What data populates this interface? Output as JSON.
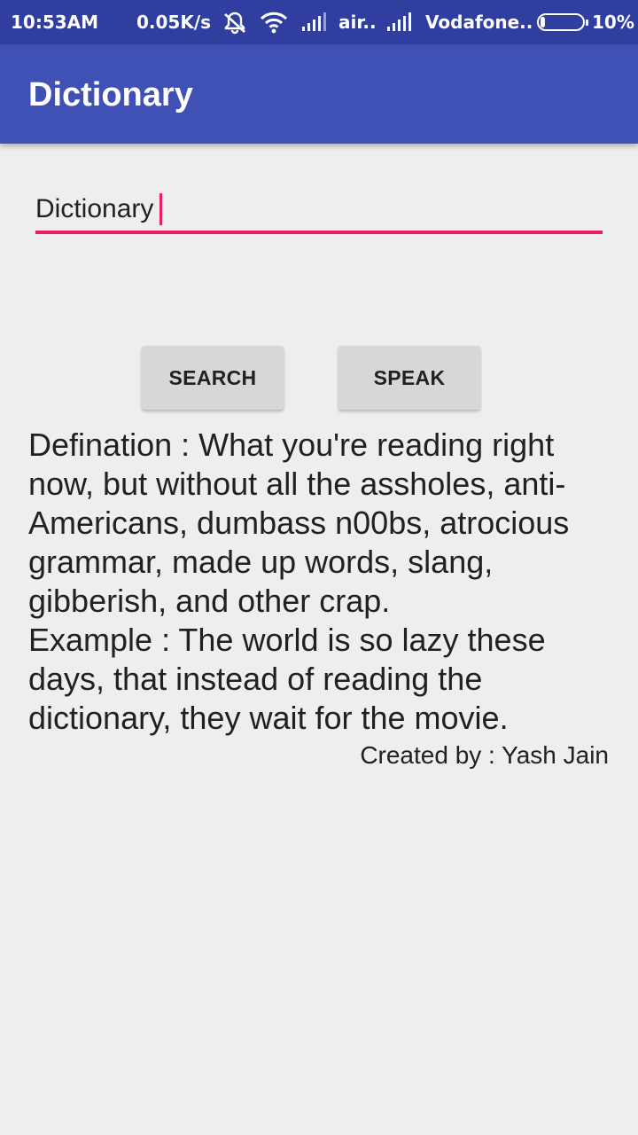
{
  "status_bar": {
    "time": "10:53AM",
    "net_speed": "0.05K/s",
    "carrier_1": "air..",
    "carrier_2": "Vodafone..",
    "battery_percent": "10%",
    "battery_level": 0.1
  },
  "app_bar": {
    "title": "Dictionary"
  },
  "search": {
    "value": "Dictionary",
    "accent_color": "#e91e63"
  },
  "buttons": {
    "search_label": "SEARCH",
    "speak_label": "SPEAK"
  },
  "result": {
    "definition_line": "Defination : What you're reading right now, but without all the assholes, anti-Americans, dumbass n00bs, atrocious grammar, made up words, slang, gibberish, and other crap.",
    "example_line": "Example : The world is so lazy these days, that instead of reading the dictionary, they wait for the movie."
  },
  "footer": {
    "credit": "Created by : Yash Jain"
  },
  "colors": {
    "status_bar": "#303f9f",
    "app_bar": "#3f51b5",
    "background": "#eeeeee",
    "button": "#d6d7d7"
  }
}
